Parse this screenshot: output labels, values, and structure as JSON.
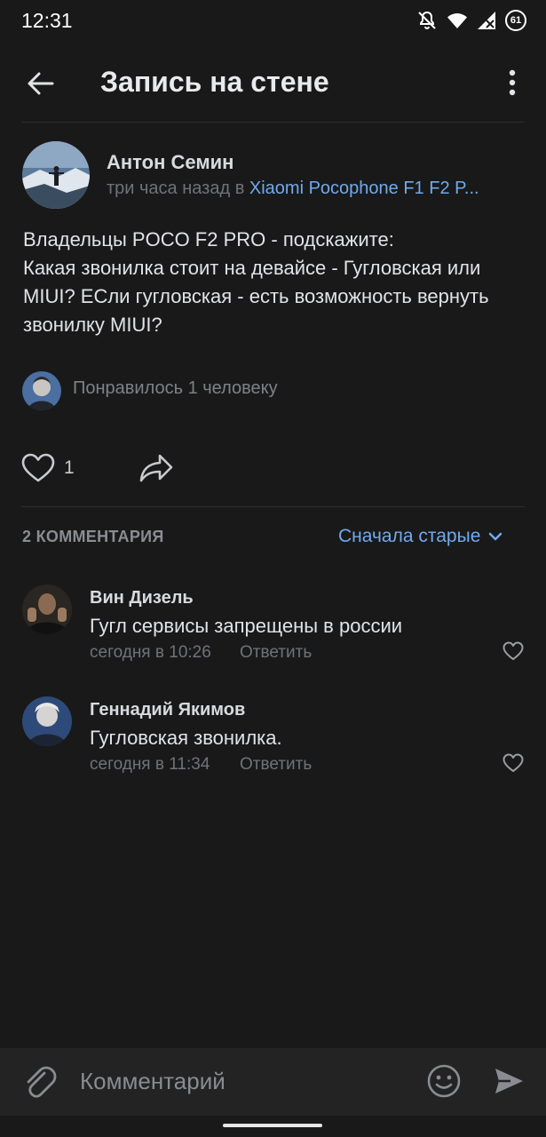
{
  "status_bar": {
    "time": "12:31",
    "battery_level": "61",
    "icons": [
      "mute-bell-icon",
      "wifi-icon",
      "cellular-signal-icon",
      "battery-icon"
    ]
  },
  "header": {
    "title": "Запись на стене",
    "back_icon": "arrow-left-icon",
    "menu_icon": "more-vertical-icon"
  },
  "post": {
    "author": "Антон Семин",
    "time_prefix": "три часа назад в ",
    "group_link": "Xiaomi Pocophone F1 F2 P...",
    "text_lines": [
      "Владельцы POCO F2 PRO - подскажите:",
      "Какая звонилка стоит на девайсе - Гугловская или",
      "MIUI? ЕСли гугловская - есть возможность вернуть",
      "звонилку MIUI?"
    ],
    "liked_by_text": "Понравилось 1 человеку",
    "likes_count": "1"
  },
  "comments_section": {
    "count_label": "2 КОММЕНТАРИЯ",
    "sort_label": "Сначала старые",
    "comments": [
      {
        "author": "Вин Дизель",
        "text": "Гугл сервисы запрещены в россии",
        "date": "сегодня в 10:26",
        "reply_label": "Ответить"
      },
      {
        "author": "Геннадий Якимов",
        "text": "Гугловская звонилка.",
        "date": "сегодня в 11:34",
        "reply_label": "Ответить"
      }
    ]
  },
  "composer": {
    "placeholder": "Комментарий",
    "attach_icon": "paperclip-icon",
    "emoji_icon": "smiley-icon",
    "send_icon": "send-icon"
  },
  "colors": {
    "background": "#19191a",
    "accent_link": "#71aaeb",
    "text_primary": "#e1e3e6",
    "text_secondary": "#6f7378"
  }
}
